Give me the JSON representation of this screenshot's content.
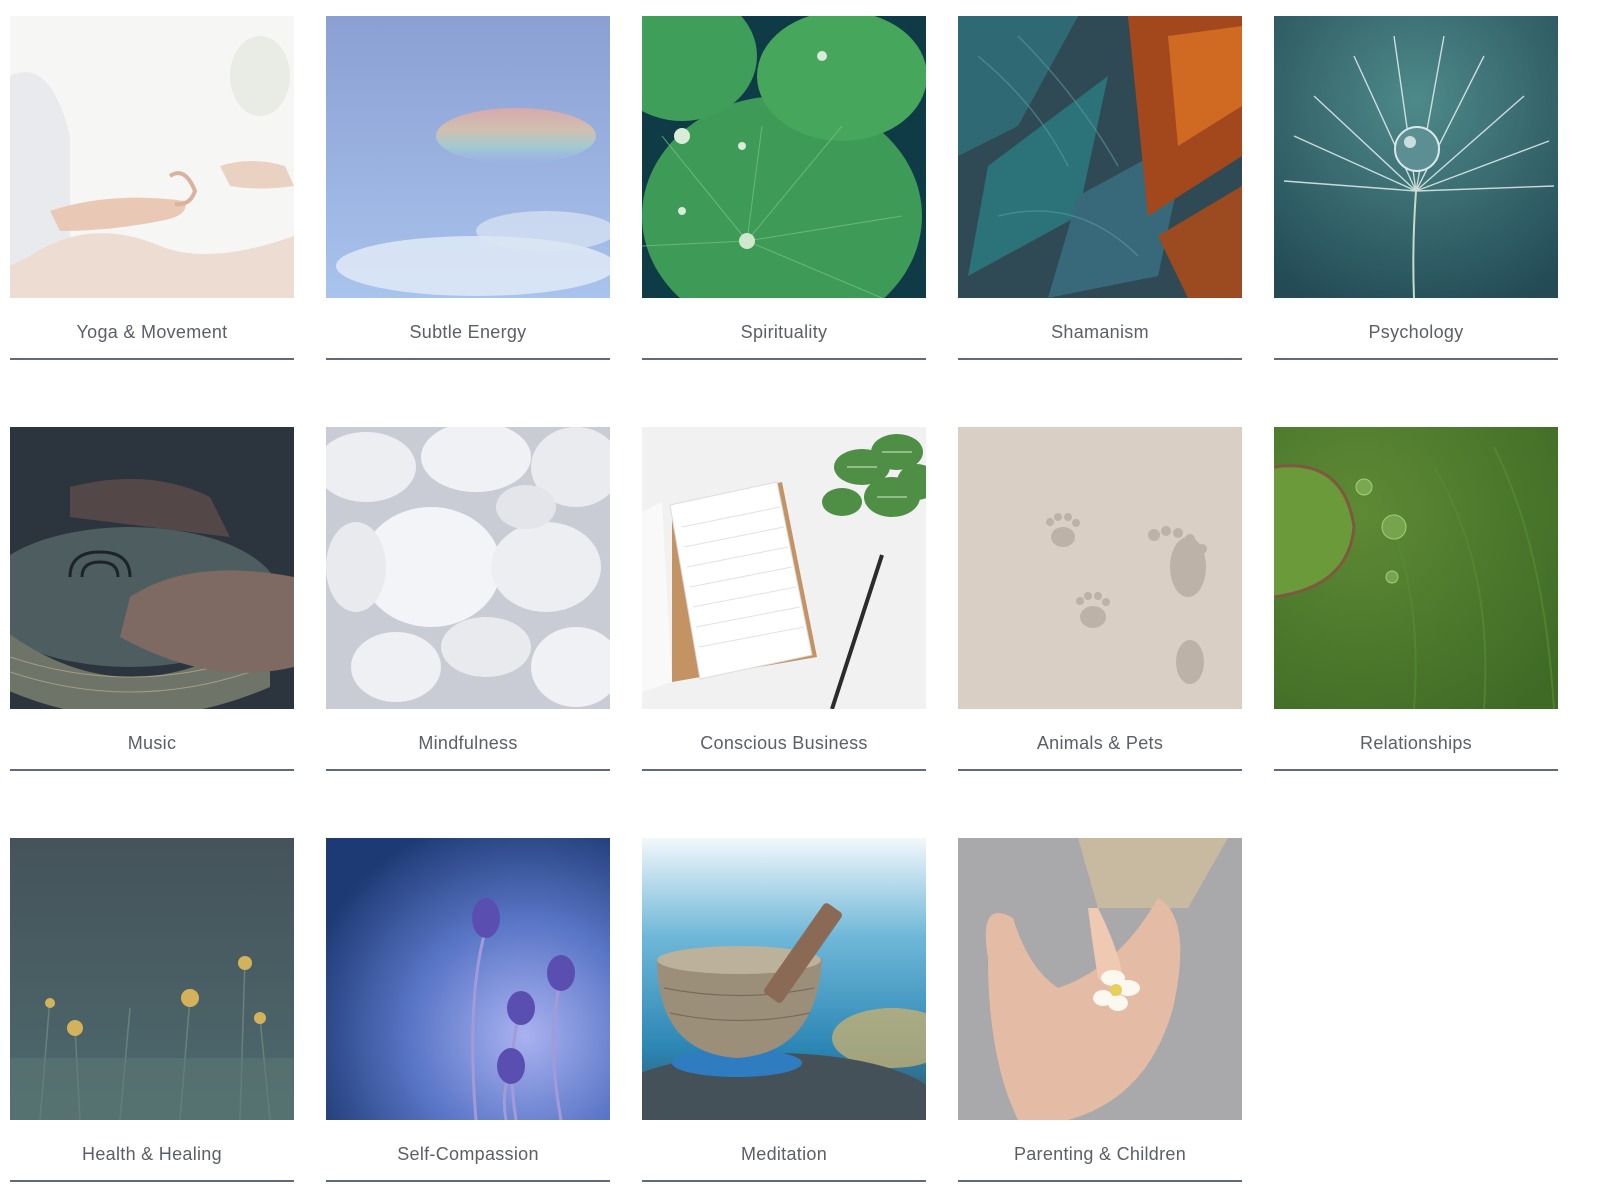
{
  "categories": [
    {
      "label": "Yoga & Movement",
      "image_icon": "yoga-hands-image"
    },
    {
      "label": "Subtle Energy",
      "image_icon": "rainbow-sky-image"
    },
    {
      "label": "Spirituality",
      "image_icon": "lotus-leaves-image"
    },
    {
      "label": "Shamanism",
      "image_icon": "feathers-image"
    },
    {
      "label": "Psychology",
      "image_icon": "dandelion-drop-image"
    },
    {
      "label": "Music",
      "image_icon": "handpan-drum-image"
    },
    {
      "label": "Mindfulness",
      "image_icon": "white-pebbles-image"
    },
    {
      "label": "Conscious Business",
      "image_icon": "notebook-plant-image"
    },
    {
      "label": "Animals & Pets",
      "image_icon": "paw-footprints-image"
    },
    {
      "label": "Relationships",
      "image_icon": "green-leaf-drops-image"
    },
    {
      "label": "Health & Healing",
      "image_icon": "wildflowers-image"
    },
    {
      "label": "Self-Compassion",
      "image_icon": "purple-flowers-image"
    },
    {
      "label": "Meditation",
      "image_icon": "singing-bowl-image"
    },
    {
      "label": "Parenting & Children",
      "image_icon": "child-hand-flower-image"
    }
  ]
}
